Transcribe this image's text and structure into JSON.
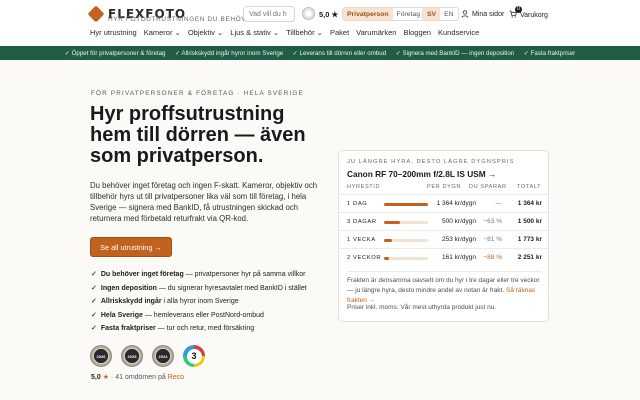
{
  "header": {
    "logo_text": "FLEXFOTO",
    "logo_sub": "HYR FOTOUTRUSTNINGEN DU BEHÖVER",
    "search_placeholder": "Vad vill du h",
    "rating": "5,0 ★",
    "audience": [
      {
        "label": "Privatperson",
        "active": true
      },
      {
        "label": "Företag",
        "active": false
      }
    ],
    "languages": [
      {
        "label": "SV",
        "active": true
      },
      {
        "label": "EN",
        "active": false
      }
    ],
    "account_label": "Mina sidor",
    "cart_label": "Varukorg",
    "cart_count": "0"
  },
  "nav": [
    "Hyr utrustning",
    "Kameror ⌄",
    "Objektiv ⌄",
    "Ljus & stativ ⌄",
    "Tillbehör ⌄",
    "Paket",
    "Varumärken",
    "Bloggen",
    "Kundservice"
  ],
  "banner": [
    "Öppet för privatpersoner & företag",
    "Allriskskydd ingår hyror inom Sverige",
    "Leverans till dörren eller ombud",
    "Signera med BankID — ingen deposition",
    "Fasta fraktpriser"
  ],
  "hero": {
    "eyebrow": "FÖR PRIVATPERSONER & FÖRETAG · HELA SVERIGE",
    "title": "Hyr proffsutrustning hem till dörren — även som privatperson.",
    "body": "Du behöver inget företag och ingen F-skatt. Kameror, objektiv och tillbehör hyrs ut till privatpersoner lika väl som till företag, i hela Sverige — signera med BankID, få utrustningen skickad och returnera med förbetald returfrakt via QR-kod.",
    "cta": "Se all utrustning →"
  },
  "features": [
    {
      "bold": "Du behöver inget företag",
      "rest": " — privatpersoner hyr på samma villkor"
    },
    {
      "bold": "Ingen deposition",
      "rest": " — du signerar hyresavtalet med BankID i stället"
    },
    {
      "bold": "Allriskskydd ingår",
      "rest": " i alla hyror inom Sverige"
    },
    {
      "bold": "Hela Sverige",
      "rest": " — hemleverans eller PostNord-ombud"
    },
    {
      "bold": "Fasta fraktpriser",
      "rest": " — tur och retur, med försäkring"
    }
  ],
  "awards": [
    "2026",
    "2025",
    "2024",
    "3"
  ],
  "reviews": {
    "score": "5,0",
    "star": "★",
    "text": " · 41 omdömen på ",
    "source": "Reco"
  },
  "price_card": {
    "eyebrow": "JU LÄNGRE HYRA, DESTO LÄGRE DYGNSPRIS",
    "title": "Canon RF 70–200mm f/2.8L IS USM →",
    "columns": [
      "HYRESTID",
      "PER DYGN",
      "DU SPARAR",
      "TOTALT"
    ],
    "rows": [
      {
        "period": "1 DAG",
        "per_day": "1 364 kr/dygn",
        "save": "—",
        "total": "1 364 kr",
        "bar": 1.0
      },
      {
        "period": "3 DAGAR",
        "per_day": "500 kr/dygn",
        "save": "−63 %",
        "total": "1 500 kr",
        "bar": 0.37
      },
      {
        "period": "1 VECKA",
        "per_day": "253 kr/dygn",
        "save": "−81 %",
        "total": "1 773 kr",
        "bar": 0.19
      },
      {
        "period": "2 VECKOR",
        "per_day": "161 kr/dygn",
        "save": "−88 %",
        "total": "2 251 kr",
        "bar": 0.12
      }
    ],
    "note": "Frakten är densamma oavsett om du hyr i tre dagar eller tre veckor — ju längre hyra, desto mindre andel av notan är frakt. ",
    "note_link": "Så räknas frakten →",
    "foot": "Priser inkl. moms. Vår mest uthyrda produkt just nu."
  }
}
